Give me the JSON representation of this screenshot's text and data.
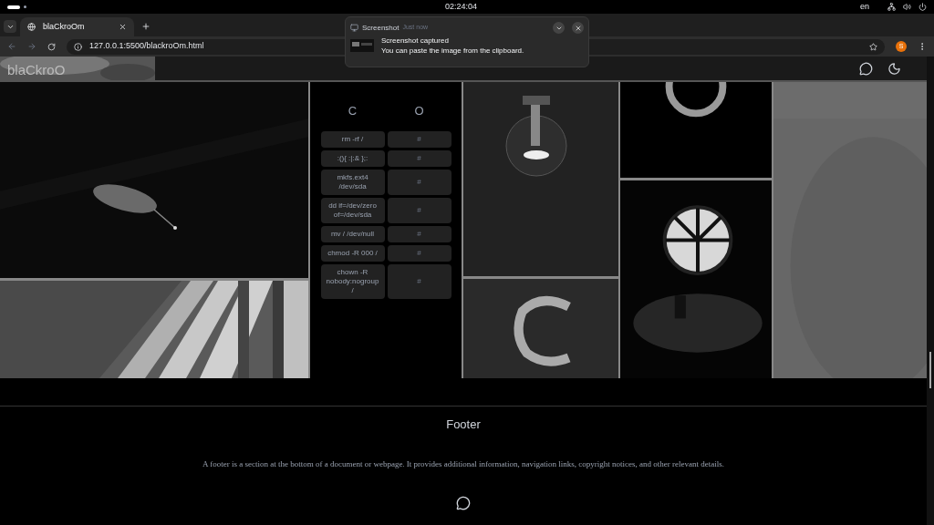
{
  "system_bar": {
    "clock": "02:24:04",
    "language": "en"
  },
  "browser": {
    "tabs": [
      {
        "title": "blaCkroOm",
        "selected": true
      }
    ],
    "url": "127.0.0.1:5500/blackroOm.html",
    "profile": "S"
  },
  "notification": {
    "app": "Screenshot",
    "time": "Just now",
    "title": "Screenshot captured",
    "body": "You can paste the image from the clipboard."
  },
  "header": {
    "logo": "blaCkroO"
  },
  "table": {
    "columns": [
      "C",
      "O"
    ],
    "rows": [
      {
        "command": "rm -rf /",
        "link": "#"
      },
      {
        "command": ":(){ :|:& };:",
        "link": "#"
      },
      {
        "command": "mkfs.ext4 /dev/sda",
        "link": "#"
      },
      {
        "command": "dd if=/dev/zero of=/dev/sda",
        "link": "#"
      },
      {
        "command": "mv / /dev/null",
        "link": "#"
      },
      {
        "command": "chmod -R 000 /",
        "link": "#"
      },
      {
        "command": "chown -R nobody:nogroup /",
        "link": "#"
      }
    ]
  },
  "footer": {
    "title": "Footer",
    "text": "A footer is a section at the bottom of a document or webpage. It provides additional information, navigation links, copyright notices, and other relevant details."
  }
}
